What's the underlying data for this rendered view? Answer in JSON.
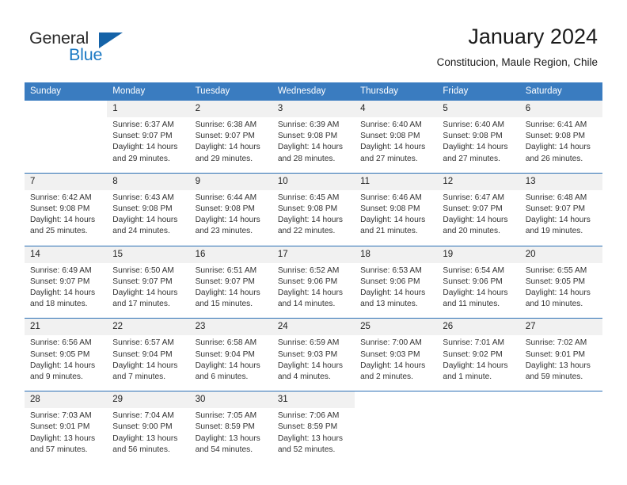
{
  "brand": {
    "name_part1": "General",
    "name_part2": "Blue"
  },
  "header": {
    "title": "January 2024",
    "subtitle": "Constitucion, Maule Region, Chile"
  },
  "calendar": {
    "weekday_headers": [
      "Sunday",
      "Monday",
      "Tuesday",
      "Wednesday",
      "Thursday",
      "Friday",
      "Saturday"
    ],
    "colors": {
      "header_blue": "#3a7cc0",
      "separator_blue": "#2a6eb4",
      "date_band_gray": "#f1f1f1",
      "brand_blue": "#1b79c3"
    },
    "weeks": [
      [
        {
          "day": "",
          "empty": true
        },
        {
          "day": "1",
          "sunrise": "Sunrise: 6:37 AM",
          "sunset": "Sunset: 9:07 PM",
          "daylight_line1": "Daylight: 14 hours",
          "daylight_line2": "and 29 minutes."
        },
        {
          "day": "2",
          "sunrise": "Sunrise: 6:38 AM",
          "sunset": "Sunset: 9:07 PM",
          "daylight_line1": "Daylight: 14 hours",
          "daylight_line2": "and 29 minutes."
        },
        {
          "day": "3",
          "sunrise": "Sunrise: 6:39 AM",
          "sunset": "Sunset: 9:08 PM",
          "daylight_line1": "Daylight: 14 hours",
          "daylight_line2": "and 28 minutes."
        },
        {
          "day": "4",
          "sunrise": "Sunrise: 6:40 AM",
          "sunset": "Sunset: 9:08 PM",
          "daylight_line1": "Daylight: 14 hours",
          "daylight_line2": "and 27 minutes."
        },
        {
          "day": "5",
          "sunrise": "Sunrise: 6:40 AM",
          "sunset": "Sunset: 9:08 PM",
          "daylight_line1": "Daylight: 14 hours",
          "daylight_line2": "and 27 minutes."
        },
        {
          "day": "6",
          "sunrise": "Sunrise: 6:41 AM",
          "sunset": "Sunset: 9:08 PM",
          "daylight_line1": "Daylight: 14 hours",
          "daylight_line2": "and 26 minutes."
        }
      ],
      [
        {
          "day": "7",
          "sunrise": "Sunrise: 6:42 AM",
          "sunset": "Sunset: 9:08 PM",
          "daylight_line1": "Daylight: 14 hours",
          "daylight_line2": "and 25 minutes."
        },
        {
          "day": "8",
          "sunrise": "Sunrise: 6:43 AM",
          "sunset": "Sunset: 9:08 PM",
          "daylight_line1": "Daylight: 14 hours",
          "daylight_line2": "and 24 minutes."
        },
        {
          "day": "9",
          "sunrise": "Sunrise: 6:44 AM",
          "sunset": "Sunset: 9:08 PM",
          "daylight_line1": "Daylight: 14 hours",
          "daylight_line2": "and 23 minutes."
        },
        {
          "day": "10",
          "sunrise": "Sunrise: 6:45 AM",
          "sunset": "Sunset: 9:08 PM",
          "daylight_line1": "Daylight: 14 hours",
          "daylight_line2": "and 22 minutes."
        },
        {
          "day": "11",
          "sunrise": "Sunrise: 6:46 AM",
          "sunset": "Sunset: 9:08 PM",
          "daylight_line1": "Daylight: 14 hours",
          "daylight_line2": "and 21 minutes."
        },
        {
          "day": "12",
          "sunrise": "Sunrise: 6:47 AM",
          "sunset": "Sunset: 9:07 PM",
          "daylight_line1": "Daylight: 14 hours",
          "daylight_line2": "and 20 minutes."
        },
        {
          "day": "13",
          "sunrise": "Sunrise: 6:48 AM",
          "sunset": "Sunset: 9:07 PM",
          "daylight_line1": "Daylight: 14 hours",
          "daylight_line2": "and 19 minutes."
        }
      ],
      [
        {
          "day": "14",
          "sunrise": "Sunrise: 6:49 AM",
          "sunset": "Sunset: 9:07 PM",
          "daylight_line1": "Daylight: 14 hours",
          "daylight_line2": "and 18 minutes."
        },
        {
          "day": "15",
          "sunrise": "Sunrise: 6:50 AM",
          "sunset": "Sunset: 9:07 PM",
          "daylight_line1": "Daylight: 14 hours",
          "daylight_line2": "and 17 minutes."
        },
        {
          "day": "16",
          "sunrise": "Sunrise: 6:51 AM",
          "sunset": "Sunset: 9:07 PM",
          "daylight_line1": "Daylight: 14 hours",
          "daylight_line2": "and 15 minutes."
        },
        {
          "day": "17",
          "sunrise": "Sunrise: 6:52 AM",
          "sunset": "Sunset: 9:06 PM",
          "daylight_line1": "Daylight: 14 hours",
          "daylight_line2": "and 14 minutes."
        },
        {
          "day": "18",
          "sunrise": "Sunrise: 6:53 AM",
          "sunset": "Sunset: 9:06 PM",
          "daylight_line1": "Daylight: 14 hours",
          "daylight_line2": "and 13 minutes."
        },
        {
          "day": "19",
          "sunrise": "Sunrise: 6:54 AM",
          "sunset": "Sunset: 9:06 PM",
          "daylight_line1": "Daylight: 14 hours",
          "daylight_line2": "and 11 minutes."
        },
        {
          "day": "20",
          "sunrise": "Sunrise: 6:55 AM",
          "sunset": "Sunset: 9:05 PM",
          "daylight_line1": "Daylight: 14 hours",
          "daylight_line2": "and 10 minutes."
        }
      ],
      [
        {
          "day": "21",
          "sunrise": "Sunrise: 6:56 AM",
          "sunset": "Sunset: 9:05 PM",
          "daylight_line1": "Daylight: 14 hours",
          "daylight_line2": "and 9 minutes."
        },
        {
          "day": "22",
          "sunrise": "Sunrise: 6:57 AM",
          "sunset": "Sunset: 9:04 PM",
          "daylight_line1": "Daylight: 14 hours",
          "daylight_line2": "and 7 minutes."
        },
        {
          "day": "23",
          "sunrise": "Sunrise: 6:58 AM",
          "sunset": "Sunset: 9:04 PM",
          "daylight_line1": "Daylight: 14 hours",
          "daylight_line2": "and 6 minutes."
        },
        {
          "day": "24",
          "sunrise": "Sunrise: 6:59 AM",
          "sunset": "Sunset: 9:03 PM",
          "daylight_line1": "Daylight: 14 hours",
          "daylight_line2": "and 4 minutes."
        },
        {
          "day": "25",
          "sunrise": "Sunrise: 7:00 AM",
          "sunset": "Sunset: 9:03 PM",
          "daylight_line1": "Daylight: 14 hours",
          "daylight_line2": "and 2 minutes."
        },
        {
          "day": "26",
          "sunrise": "Sunrise: 7:01 AM",
          "sunset": "Sunset: 9:02 PM",
          "daylight_line1": "Daylight: 14 hours",
          "daylight_line2": "and 1 minute."
        },
        {
          "day": "27",
          "sunrise": "Sunrise: 7:02 AM",
          "sunset": "Sunset: 9:01 PM",
          "daylight_line1": "Daylight: 13 hours",
          "daylight_line2": "and 59 minutes."
        }
      ],
      [
        {
          "day": "28",
          "sunrise": "Sunrise: 7:03 AM",
          "sunset": "Sunset: 9:01 PM",
          "daylight_line1": "Daylight: 13 hours",
          "daylight_line2": "and 57 minutes."
        },
        {
          "day": "29",
          "sunrise": "Sunrise: 7:04 AM",
          "sunset": "Sunset: 9:00 PM",
          "daylight_line1": "Daylight: 13 hours",
          "daylight_line2": "and 56 minutes."
        },
        {
          "day": "30",
          "sunrise": "Sunrise: 7:05 AM",
          "sunset": "Sunset: 8:59 PM",
          "daylight_line1": "Daylight: 13 hours",
          "daylight_line2": "and 54 minutes."
        },
        {
          "day": "31",
          "sunrise": "Sunrise: 7:06 AM",
          "sunset": "Sunset: 8:59 PM",
          "daylight_line1": "Daylight: 13 hours",
          "daylight_line2": "and 52 minutes."
        },
        {
          "day": "",
          "empty": true
        },
        {
          "day": "",
          "empty": true
        },
        {
          "day": "",
          "empty": true
        }
      ]
    ]
  }
}
